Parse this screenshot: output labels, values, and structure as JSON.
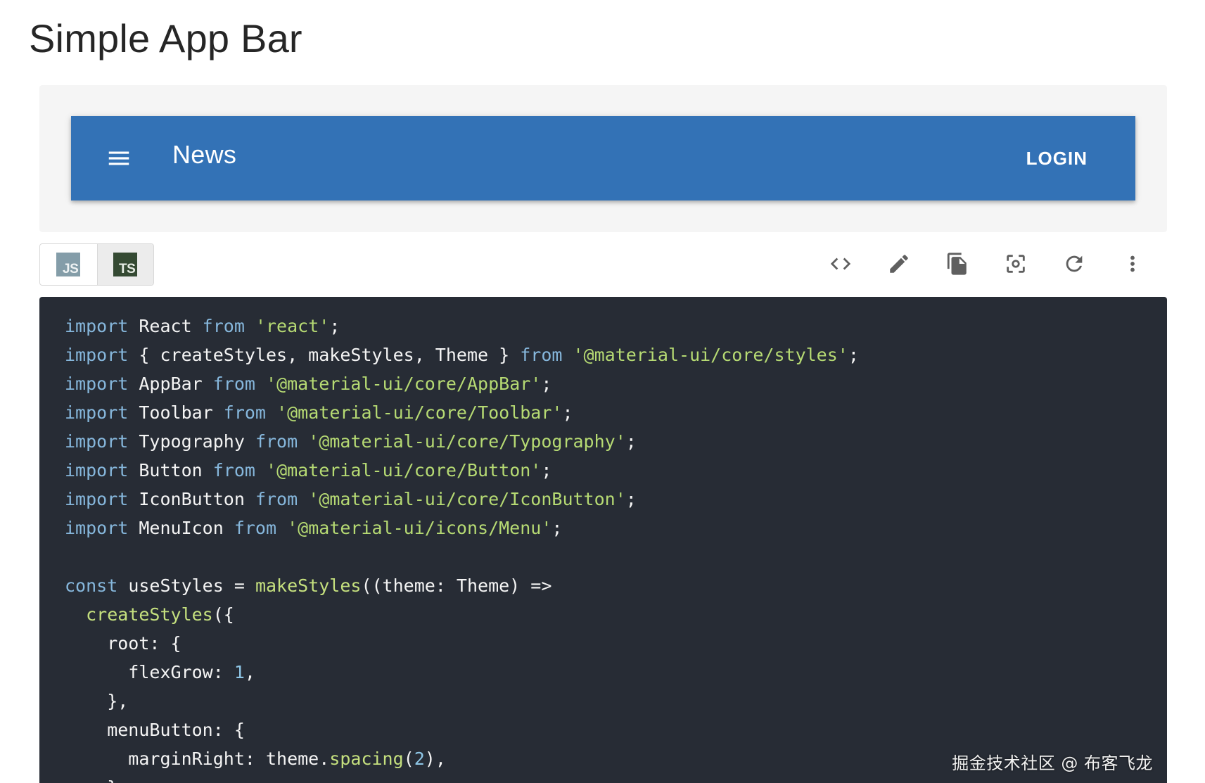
{
  "page": {
    "title": "Simple App Bar"
  },
  "demo": {
    "appbar": {
      "title": "News",
      "login_label": "LOGIN",
      "background": "#3372b6",
      "menu_icon": "hamburger-menu-icon"
    }
  },
  "lang_toggle": {
    "options": [
      {
        "label": "JS",
        "selected": false
      },
      {
        "label": "TS",
        "selected": true
      }
    ]
  },
  "toolbar": {
    "icons": [
      "code-icon",
      "edit-icon",
      "copy-icon",
      "screenshot-icon",
      "refresh-icon",
      "more-vert-icon"
    ]
  },
  "code": {
    "lines": [
      [
        [
          "kw",
          "import"
        ],
        [
          "p",
          " React "
        ],
        [
          "kw",
          "from"
        ],
        [
          "p",
          " "
        ],
        [
          "str",
          "'react'"
        ],
        [
          "p",
          ";"
        ]
      ],
      [
        [
          "kw",
          "import"
        ],
        [
          "p",
          " { createStyles, makeStyles, Theme } "
        ],
        [
          "kw",
          "from"
        ],
        [
          "p",
          " "
        ],
        [
          "str",
          "'@material-ui/core/styles'"
        ],
        [
          "p",
          ";"
        ]
      ],
      [
        [
          "kw",
          "import"
        ],
        [
          "p",
          " AppBar "
        ],
        [
          "kw",
          "from"
        ],
        [
          "p",
          " "
        ],
        [
          "str",
          "'@material-ui/core/AppBar'"
        ],
        [
          "p",
          ";"
        ]
      ],
      [
        [
          "kw",
          "import"
        ],
        [
          "p",
          " Toolbar "
        ],
        [
          "kw",
          "from"
        ],
        [
          "p",
          " "
        ],
        [
          "str",
          "'@material-ui/core/Toolbar'"
        ],
        [
          "p",
          ";"
        ]
      ],
      [
        [
          "kw",
          "import"
        ],
        [
          "p",
          " Typography "
        ],
        [
          "kw",
          "from"
        ],
        [
          "p",
          " "
        ],
        [
          "str",
          "'@material-ui/core/Typography'"
        ],
        [
          "p",
          ";"
        ]
      ],
      [
        [
          "kw",
          "import"
        ],
        [
          "p",
          " Button "
        ],
        [
          "kw",
          "from"
        ],
        [
          "p",
          " "
        ],
        [
          "str",
          "'@material-ui/core/Button'"
        ],
        [
          "p",
          ";"
        ]
      ],
      [
        [
          "kw",
          "import"
        ],
        [
          "p",
          " IconButton "
        ],
        [
          "kw",
          "from"
        ],
        [
          "p",
          " "
        ],
        [
          "str",
          "'@material-ui/core/IconButton'"
        ],
        [
          "p",
          ";"
        ]
      ],
      [
        [
          "kw",
          "import"
        ],
        [
          "p",
          " MenuIcon "
        ],
        [
          "kw",
          "from"
        ],
        [
          "p",
          " "
        ],
        [
          "str",
          "'@material-ui/icons/Menu'"
        ],
        [
          "p",
          ";"
        ]
      ],
      [],
      [
        [
          "kw",
          "const"
        ],
        [
          "p",
          " useStyles = "
        ],
        [
          "fn",
          "makeStyles"
        ],
        [
          "p",
          "((theme: Theme) =>"
        ]
      ],
      [
        [
          "p",
          "  "
        ],
        [
          "fn",
          "createStyles"
        ],
        [
          "p",
          "({"
        ]
      ],
      [
        [
          "p",
          "    root: {"
        ]
      ],
      [
        [
          "p",
          "      flexGrow: "
        ],
        [
          "num",
          "1"
        ],
        [
          "p",
          ","
        ]
      ],
      [
        [
          "p",
          "    },"
        ]
      ],
      [
        [
          "p",
          "    menuButton: {"
        ]
      ],
      [
        [
          "p",
          "      marginRight: theme."
        ],
        [
          "fn",
          "spacing"
        ],
        [
          "p",
          "("
        ],
        [
          "num",
          "2"
        ],
        [
          "p",
          "),"
        ]
      ],
      [
        [
          "p",
          "    },"
        ]
      ]
    ]
  },
  "watermark": "掘金技术社区 @ 布客飞龙",
  "colors": {
    "code_bg": "#272c35",
    "keyword": "#86b7dc",
    "string": "#b6da73",
    "function": "#c5e07e",
    "number": "#8ec6e6"
  }
}
